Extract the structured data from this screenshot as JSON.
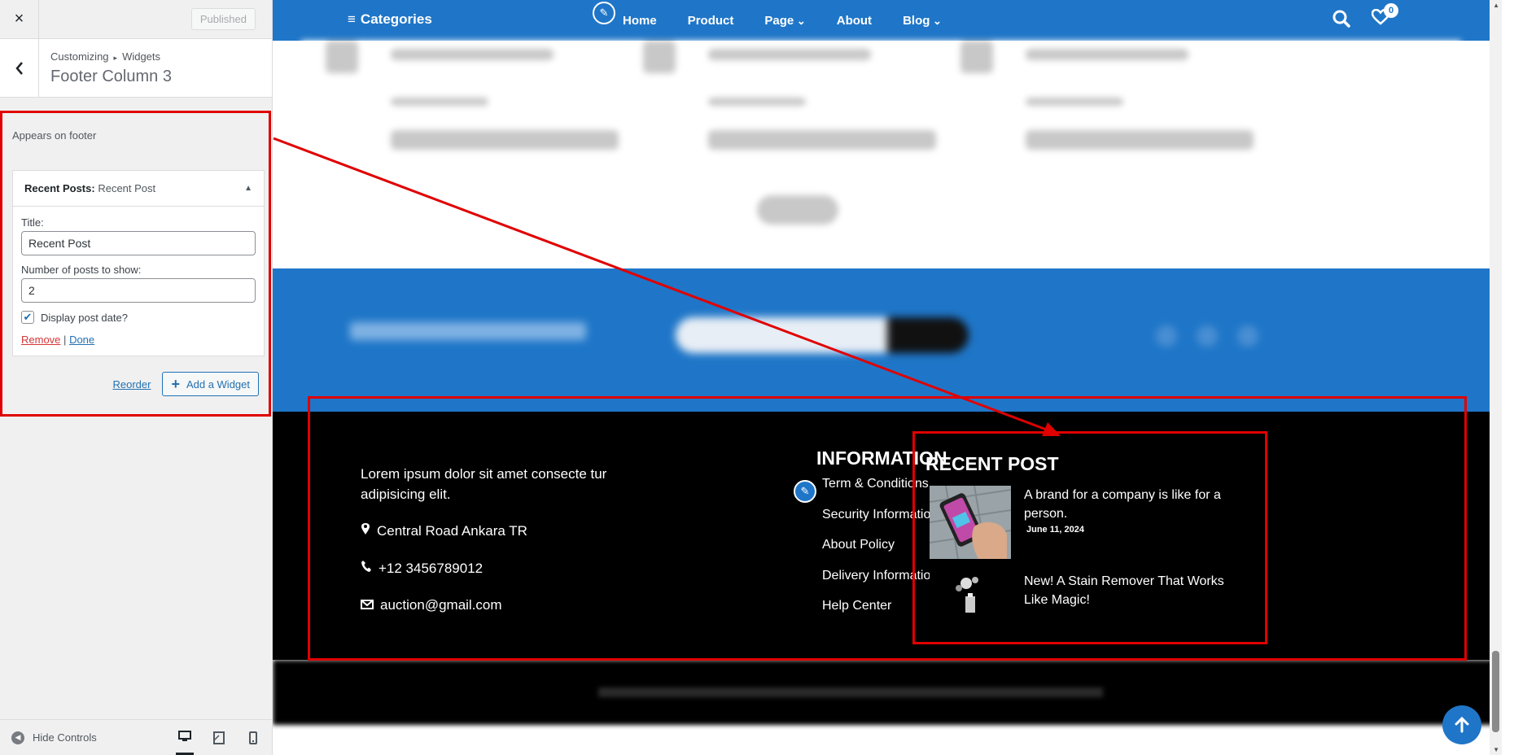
{
  "customizer": {
    "close_icon": "×",
    "published_label": "Published",
    "breadcrumb_parent": "Customizing",
    "breadcrumb_child": "Widgets",
    "section_title": "Footer Column 3",
    "description": "Appears on footer",
    "widget": {
      "type_label": "Recent Posts:",
      "instance_title": "Recent Post",
      "title_label": "Title:",
      "title_value": "Recent Post",
      "posts_label": "Number of posts to show:",
      "posts_value": "2",
      "date_label": "Display post date?",
      "date_checked": true,
      "remove_label": "Remove",
      "separator": "|",
      "done_label": "Done"
    },
    "reorder_label": "Reorder",
    "add_widget_label": "Add a Widget",
    "hide_controls_label": "Hide Controls"
  },
  "preview": {
    "nav": {
      "categories_label": "Categories",
      "links": [
        "Home",
        "Product",
        "Page",
        "About",
        "Blog"
      ],
      "wishlist_count": "0"
    },
    "footer": {
      "about_text": "Lorem ipsum dolor sit amet consecte tur adipisicing elit.",
      "address": "Central Road Ankara TR",
      "phone": "+12 3456789012",
      "email": "auction@gmail.com",
      "info_title": "INFORMATION",
      "info_links": [
        "Term & Conditions",
        "Security Information",
        "About Policy",
        "Delivery Information",
        "Help Center"
      ],
      "recent_title": "RECENT POST",
      "posts": [
        {
          "title": "A brand for a company is like for a person.",
          "date": "June 11, 2024"
        },
        {
          "title": "New! A Stain Remover That Works Like Magic!",
          "date": ""
        }
      ]
    }
  },
  "colors": {
    "brand_blue": "#1f76c8",
    "annotation_red": "#e00000",
    "footer_bg": "#000000"
  }
}
